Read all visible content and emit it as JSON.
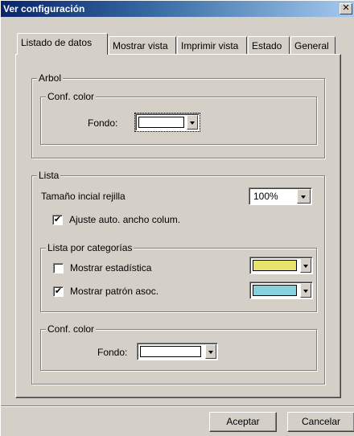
{
  "window": {
    "title": "Ver configuración",
    "close_glyph": "✕"
  },
  "tabs": [
    {
      "label": "Listado de datos",
      "active": true
    },
    {
      "label": "Mostrar vista",
      "active": false
    },
    {
      "label": "Imprimir vista",
      "active": false
    },
    {
      "label": "Estado",
      "active": false
    },
    {
      "label": "General",
      "active": false
    }
  ],
  "arbol": {
    "legend": "Arbol",
    "conf_color": {
      "legend": "Conf. color",
      "fondo_label": "Fondo:",
      "fondo_color": "#ffffff"
    }
  },
  "lista": {
    "legend": "Lista",
    "tamano_label": "Tamaño incial rejilla",
    "tamano_value": "100%",
    "ajuste_label": "Ajuste auto. ancho colum.",
    "ajuste_checked": true,
    "categorias": {
      "legend": "Lista por categorías",
      "estadistica_label": "Mostrar estadística",
      "estadistica_checked": false,
      "estadistica_color": "#e6e46c",
      "patron_label": "Mostrar patrón asoc.",
      "patron_checked": true,
      "patron_color": "#86d2dc"
    },
    "conf_color": {
      "legend": "Conf. color",
      "fondo_label": "Fondo:",
      "fondo_color": "#ffffff"
    }
  },
  "buttons": {
    "aceptar": "Aceptar",
    "cancelar": "Cancelar"
  }
}
